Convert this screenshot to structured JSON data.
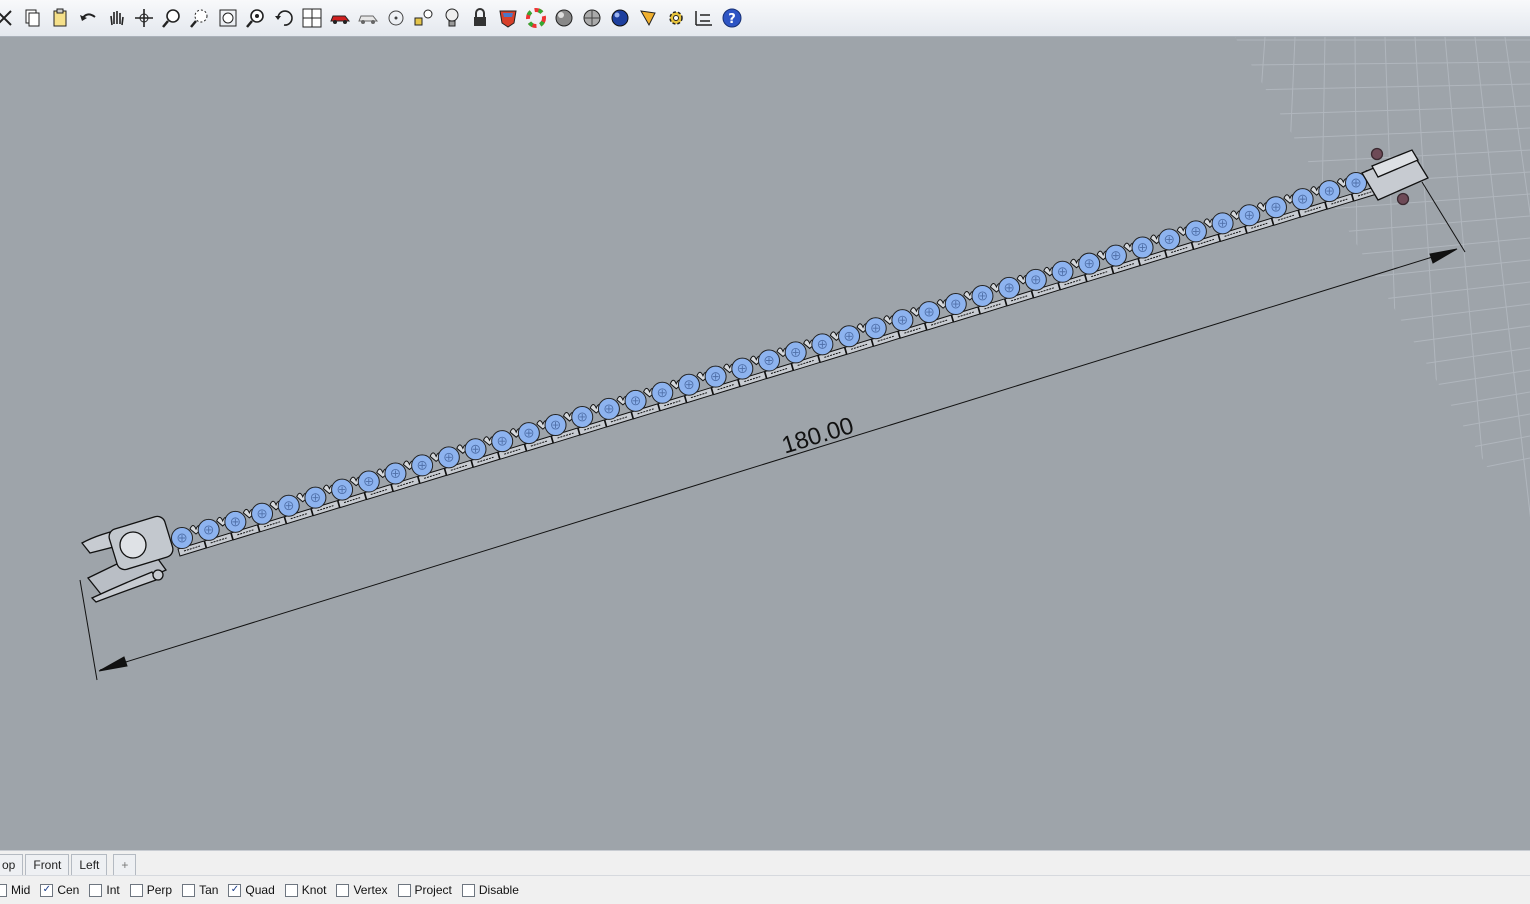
{
  "toolbar": {
    "icons": [
      "close-arrow-icon",
      "copy-icon",
      "paste-icon",
      "undo-icon",
      "pan-hand-icon",
      "move-view-icon",
      "zoom-icon",
      "zoom-window-icon",
      "zoom-extents-icon",
      "zoom-selected-icon",
      "rotate-view-icon",
      "four-viewports-icon",
      "car-icon",
      "car-outline-icon",
      "circle-point-icon",
      "shapes-icon",
      "light-bulb-icon",
      "lock-icon",
      "shield-icon",
      "color-wheel-icon",
      "sphere-gray-icon",
      "sphere-shaded-icon",
      "sphere-blue-icon",
      "pencil-icon",
      "gear-icon",
      "dimension-icon",
      "help-icon"
    ]
  },
  "viewport": {
    "dimension_text": "180.00",
    "colors": {
      "background": "#9ea4aa",
      "stone": "#8db3ef",
      "metal": "#c7cbd1",
      "grid": "#a9afb6"
    }
  },
  "tabs": [
    "op",
    "Front",
    "Left"
  ],
  "add_tab_symbol": "+",
  "snaps": [
    {
      "label": "Mid",
      "checked": false
    },
    {
      "label": "Cen",
      "checked": true
    },
    {
      "label": "Int",
      "checked": false
    },
    {
      "label": "Perp",
      "checked": false
    },
    {
      "label": "Tan",
      "checked": false
    },
    {
      "label": "Quad",
      "checked": true
    },
    {
      "label": "Knot",
      "checked": false
    },
    {
      "label": "Vertex",
      "checked": false
    },
    {
      "label": "Project",
      "checked": false
    },
    {
      "label": "Disable",
      "checked": false
    }
  ]
}
